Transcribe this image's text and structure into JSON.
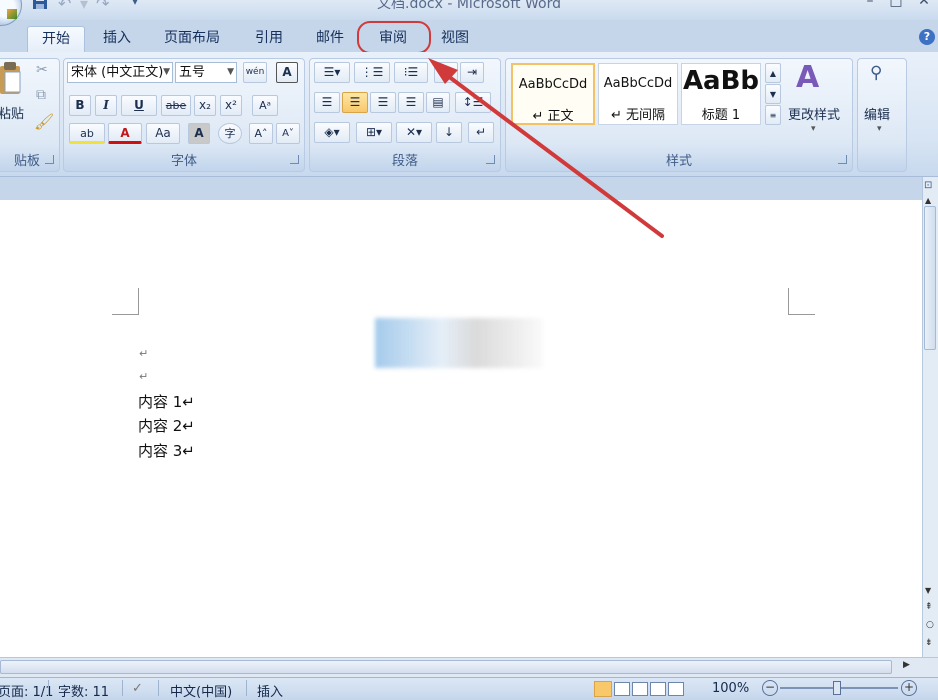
{
  "window": {
    "title": "文档.docx - Microsoft Word",
    "minimize": "–",
    "maximize": "□",
    "close": "✕"
  },
  "qat": {
    "save_icon": "save-icon",
    "undo_icon": "undo-icon",
    "redo_icon": "redo-icon",
    "customize": "▾"
  },
  "tabs": [
    {
      "label": "开始",
      "active": true
    },
    {
      "label": "插入"
    },
    {
      "label": "页面布局"
    },
    {
      "label": "引用"
    },
    {
      "label": "邮件"
    },
    {
      "label": "审阅",
      "highlighted": true
    },
    {
      "label": "视图"
    }
  ],
  "help": "?",
  "ribbon": {
    "clipboard": {
      "label": "贴板",
      "paste": "粘贴"
    },
    "font": {
      "label": "字体",
      "font_name": "宋体 (中文正文)",
      "font_size": "五号",
      "wen": "wén",
      "char_border": "A",
      "bold": "B",
      "italic": "I",
      "underline": "U",
      "strike": "abe",
      "subscript": "x₂",
      "superscript": "x²",
      "clear_format": "Aᵃ",
      "highlight": "ab",
      "font_color": "A",
      "change_case": "Aa",
      "char_shading": "A",
      "enclose": "字",
      "grow": "A˄",
      "shrink": "A˅"
    },
    "paragraph": {
      "label": "段落"
    },
    "styles": {
      "label": "样式",
      "cards": [
        {
          "sample": "AaBbCcDd",
          "name": "↵ 正文",
          "selected": true
        },
        {
          "sample": "AaBbCcDd",
          "name": "↵ 无间隔"
        },
        {
          "sample": "AaBb",
          "name": "标题 1"
        }
      ],
      "change_styles": "更改样式"
    },
    "editing": {
      "label": "编辑"
    }
  },
  "document": {
    "paragraphs": [
      "↵",
      "↵",
      "内容 1↵",
      "内容 2↵",
      "内容 3↵"
    ]
  },
  "statusbar": {
    "page": "页面: 1/1",
    "words": "字数: 11",
    "language": "中文(中国)",
    "mode": "插入",
    "zoom": "100%"
  },
  "colors": {
    "annotation_red": "#d03a3a",
    "ribbon_blue": "#d7e4f3"
  }
}
